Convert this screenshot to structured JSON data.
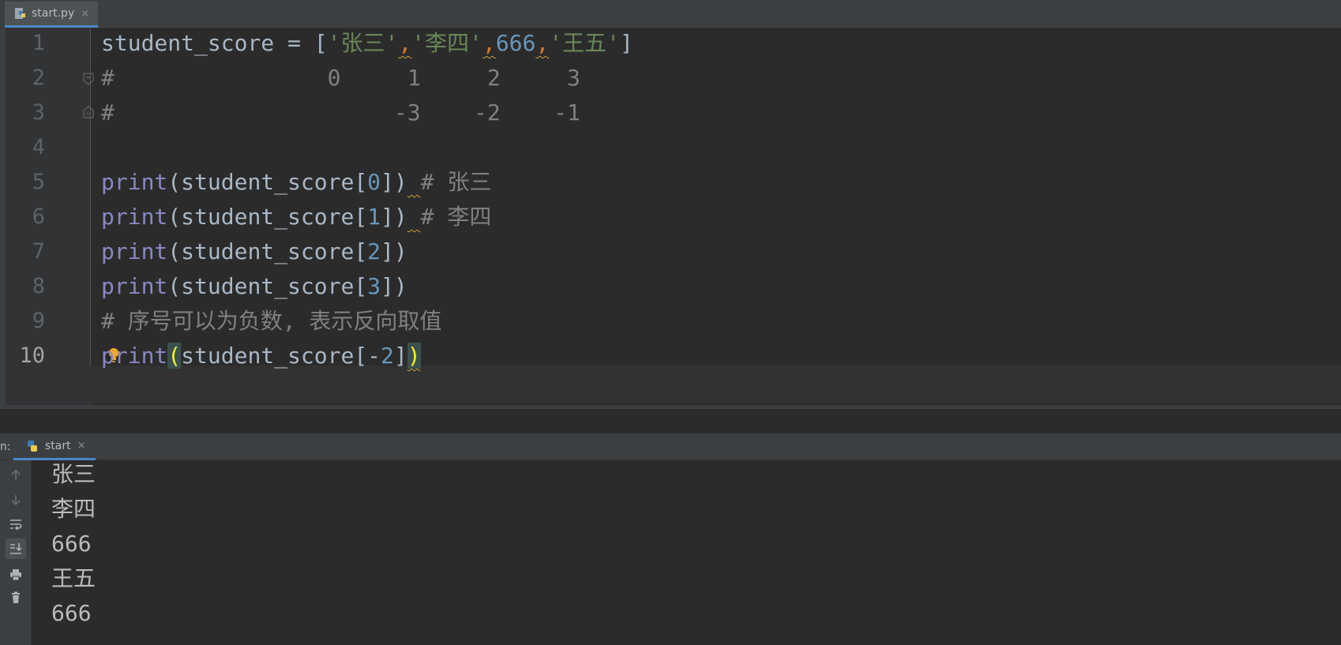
{
  "editor_tab": {
    "label": "start.py",
    "close": "×",
    "icon": "python-file-icon"
  },
  "editor": {
    "current_line": 10,
    "line_numbers": [
      "1",
      "2",
      "3",
      "4",
      "5",
      "6",
      "7",
      "8",
      "9",
      "10"
    ],
    "code": {
      "l1": {
        "ident": "student_score",
        "assign": " = ",
        "lb": "[",
        "s1": "'张三'",
        "c1": ",",
        "s2": "'李四'",
        "c2": ",",
        "n1": "666",
        "c3": ",",
        "s3": "'王五'",
        "rb": "]"
      },
      "l2": {
        "text": "#                0     1     2     3"
      },
      "l3": {
        "text": "#                     -3    -2    -1"
      },
      "l5": {
        "fn": "print",
        "open": "(",
        "arg": "student_score",
        "lb": "[",
        "idx": "0",
        "close": "])",
        "sp": " ",
        "comment": "# 张三"
      },
      "l6": {
        "fn": "print",
        "open": "(",
        "arg": "student_score",
        "lb": "[",
        "idx": "1",
        "close": "])",
        "sp": " ",
        "comment": "# 李四"
      },
      "l7": {
        "fn": "print",
        "open": "(",
        "arg": "student_score",
        "lb": "[",
        "idx": "2",
        "close": "])"
      },
      "l8": {
        "fn": "print",
        "open": "(",
        "arg": "student_score",
        "lb": "[",
        "idx": "3",
        "close": "])"
      },
      "l9": {
        "hash": "#",
        "comment": " 序号可以为负数, 表示反向取值"
      },
      "l10": {
        "fn": "print",
        "open": "(",
        "arg": "student_score",
        "lb": "[",
        "neg": "-",
        "idx": "2",
        "rb": "]",
        "close": ")"
      }
    }
  },
  "run_panel": {
    "prefix": "n:",
    "tab_label": "start",
    "close": "×",
    "icons": [
      "arrow-up-icon",
      "arrow-down-icon",
      "soft-wrap-icon",
      "scroll-to-end-icon",
      "print-icon",
      "trash-icon"
    ],
    "output": [
      "张三",
      "李四",
      "666",
      "王五",
      "666"
    ]
  },
  "colors": {
    "background": "#2b2b2b",
    "keyword": "#8888c6",
    "string": "#6a8759",
    "number": "#6897bb",
    "comment": "#808080",
    "accent": "#4a88c7"
  }
}
